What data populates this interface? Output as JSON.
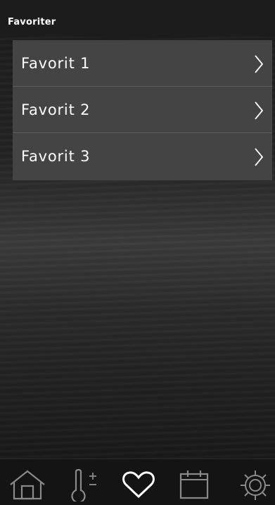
{
  "header": {
    "title": "Favoriter"
  },
  "favorites": [
    {
      "label": "Favorit 1"
    },
    {
      "label": "Favorit 2"
    },
    {
      "label": "Favorit 3"
    }
  ],
  "tabbar": {
    "tabs": [
      {
        "icon": "home-icon"
      },
      {
        "icon": "thermometer-plus-minus-icon"
      },
      {
        "icon": "heart-icon",
        "active": true
      },
      {
        "icon": "calendar-icon"
      },
      {
        "icon": "gear-icon"
      }
    ]
  }
}
